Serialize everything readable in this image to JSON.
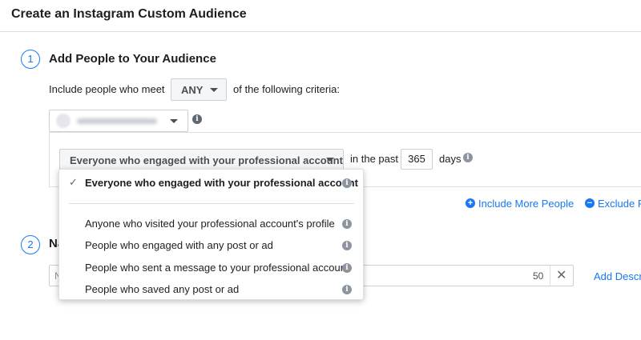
{
  "header": {
    "title": "Create an Instagram Custom Audience"
  },
  "step1": {
    "number": "1",
    "title": "Add People to Your Audience",
    "include_prefix": "Include people who meet",
    "match_value": "ANY",
    "include_suffix": "of the following criteria:",
    "engagement_value": "Everyone who engaged with your professional account",
    "in_the_past": "in the past",
    "days_value": "365",
    "days_label": "days",
    "include_more": "Include More People",
    "exclude": "Exclude P"
  },
  "step2": {
    "number": "2",
    "title": "Na",
    "name_placeholder": "N",
    "char_count": "50",
    "add_description": "Add Descr"
  },
  "dropdown": {
    "selected": "Everyone who engaged with your professional account",
    "options": [
      "Anyone who visited your professional account's profile",
      "People who engaged with any post or ad",
      "People who sent a message to your professional account",
      "People who saved any post or ad"
    ]
  },
  "icons": {
    "check": "✓",
    "info": "i",
    "plus": "+",
    "minus": "−",
    "close": "✕"
  },
  "colors": {
    "accent": "#1877f2",
    "text": "#1c1e21",
    "border": "#ccd0d5"
  }
}
